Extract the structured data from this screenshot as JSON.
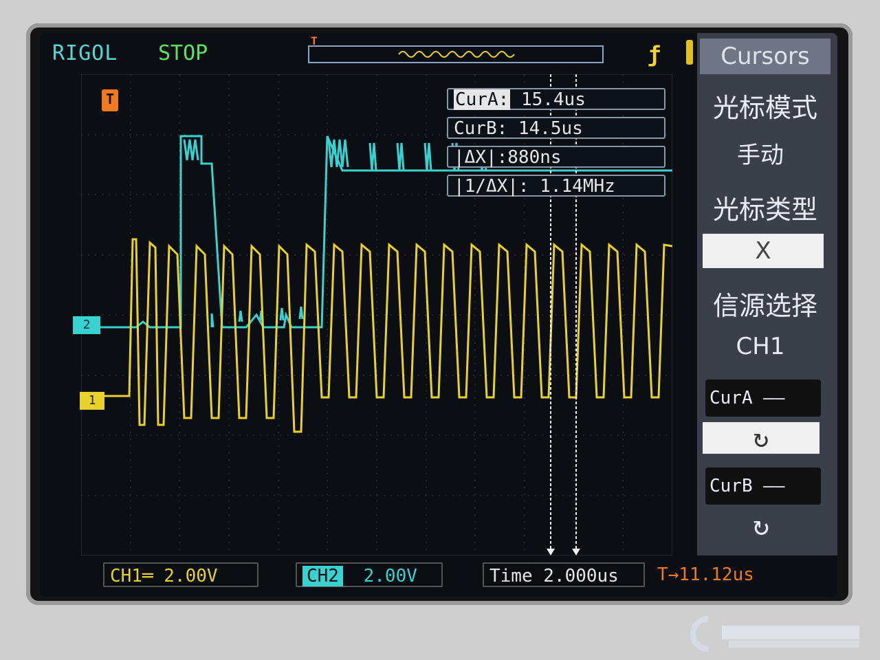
{
  "header": {
    "brand": "RIGOL",
    "run_state": "STOP",
    "trigger_marker": "T"
  },
  "markers": {
    "trigger": "T",
    "ch2": "2",
    "ch1": "1"
  },
  "cursors_readout": {
    "cur_a_label": "CurA:",
    "cur_a_value": "15.4us",
    "cur_b": "CurB: 14.5us",
    "delta_x": "|ΔX|:880ns",
    "inv_delta_x": "|1/ΔX|: 1.14MHz"
  },
  "menu": {
    "title": "Cursors",
    "mode_label": "光标模式",
    "mode_value": "手动",
    "type_label": "光标类型",
    "type_value": "X",
    "source_label": "信源选择",
    "source_value": "CH1",
    "cur_a_button": "CurA ——",
    "cur_b_button": "CurB ——",
    "knob_a": "↻",
    "knob_b": "↻"
  },
  "bottom": {
    "ch1_scale": "CH1═  2.00V",
    "ch2_label": "CH2",
    "ch2_scale": "2.00V",
    "time_base": "Time 2.000us",
    "trigger_offset": "T→11.12us"
  },
  "colors": {
    "ch1": "#e8d12c",
    "ch2": "#3ad1d1",
    "trigger": "#f07a1f",
    "cursor": "#f2f2f2"
  }
}
